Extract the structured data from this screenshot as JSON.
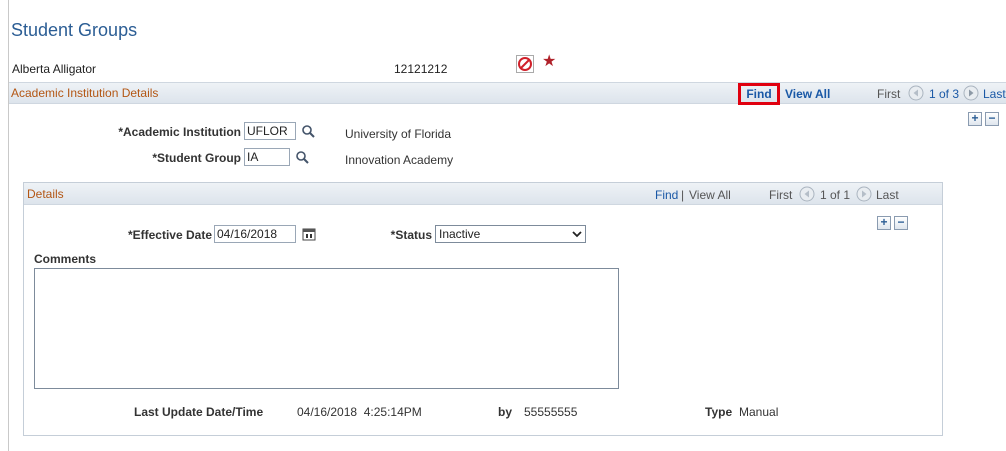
{
  "header": {
    "title": "Student Groups",
    "student_name": "Alberta Alligator",
    "student_id": "12121212"
  },
  "academic_section": {
    "title": "Academic Institution Details",
    "find_label": "Find",
    "view_all_label": "View All",
    "nav_first": "First",
    "nav_count": "1 of 3",
    "nav_last": "Last",
    "institution_label": "*Academic Institution",
    "institution_value": "UFLOR",
    "institution_desc": "University of Florida",
    "group_label": "*Student Group",
    "group_value": "IA",
    "group_desc": "Innovation Academy"
  },
  "details": {
    "title": "Details",
    "find_label": "Find",
    "separator": "|",
    "view_all_label": "View All",
    "nav_first": "First",
    "nav_count": "1 of 1",
    "nav_last": "Last",
    "effective_date_label": "*Effective Date",
    "effective_date_value": "04/16/2018",
    "status_label": "*Status",
    "status_value": "Inactive",
    "comments_label": "Comments",
    "comments_value": "",
    "last_update_label": "Last Update Date/Time",
    "last_update_value": "04/16/2018  4:25:14PM",
    "by_label": "by",
    "by_value": "55555555",
    "type_label": "Type",
    "type_value": "Manual"
  },
  "buttons": {
    "plus": "+",
    "minus": "−"
  },
  "colors": {
    "title_blue": "#2b5d94",
    "section_orange": "#b35614",
    "link_blue": "#1a58a6",
    "highlight_red": "#e0000f",
    "alert_red": "#b0222a"
  },
  "icons": {
    "alert": "no-entry-icon",
    "star": "star-icon",
    "lookup": "magnifier-icon",
    "calendar": "calendar-icon",
    "prev": "arrow-left-circle-icon",
    "next": "arrow-right-circle-icon"
  },
  "glyphs": {
    "star": "★"
  }
}
